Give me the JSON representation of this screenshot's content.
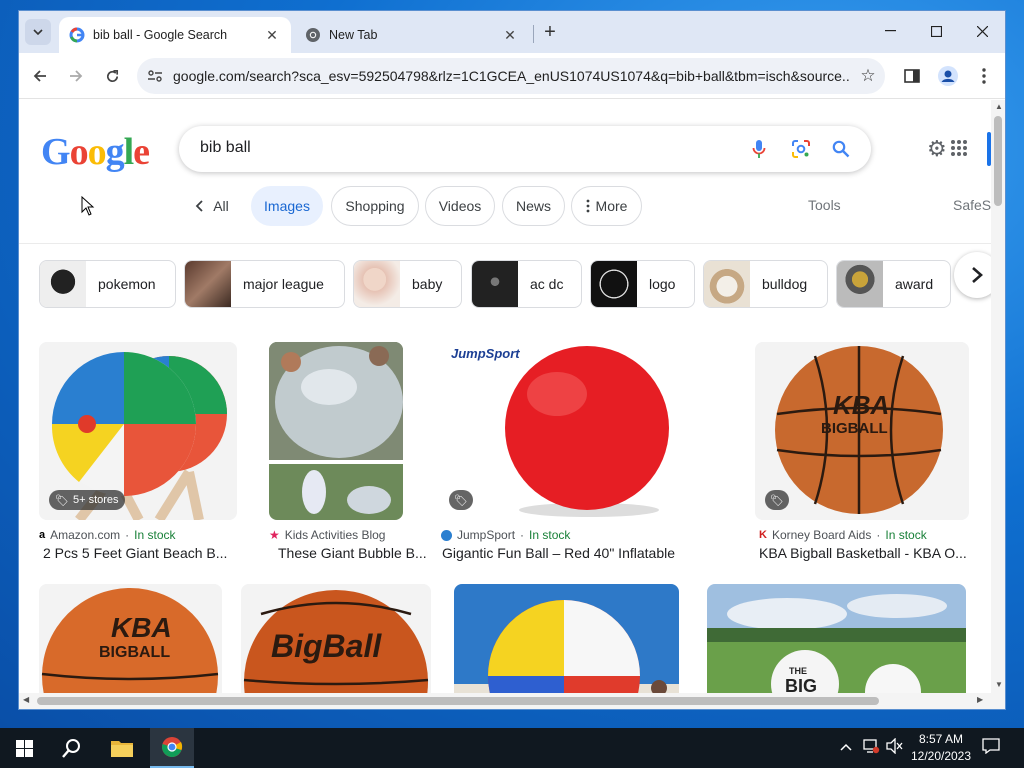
{
  "browser": {
    "tabs": [
      {
        "title": "bib ball - Google Search",
        "active": true
      },
      {
        "title": "New Tab",
        "active": false
      }
    ],
    "url": "google.com/search?sca_esv=592504798&rlz=1C1GCEA_enUS1074US1074&q=bib+ball&tbm=isch&source...",
    "icons": {
      "back": "back-arrow-icon",
      "forward": "forward-arrow-icon",
      "reload": "reload-icon",
      "bookmark": "star-icon",
      "sidepanel": "side-panel-icon",
      "profile": "profile-icon",
      "menu": "kebab-menu-icon"
    }
  },
  "google": {
    "logo_letters": [
      "G",
      "o",
      "o",
      "g",
      "l",
      "e"
    ],
    "logo_colors": [
      "#4285f4",
      "#ea4335",
      "#fbbc05",
      "#4285f4",
      "#34a853",
      "#ea4335"
    ],
    "query": "bib ball",
    "filters": {
      "back_all": "All",
      "chips": [
        "Images",
        "Shopping",
        "Videos",
        "News"
      ],
      "more": "More",
      "tools": "Tools",
      "safesearch": "SafeS"
    },
    "related": [
      {
        "label": "pokemon",
        "color": "#2b2b2b"
      },
      {
        "label": "major league",
        "color": "#6a4a3a"
      },
      {
        "label": "baby",
        "color": "#d9b9a6"
      },
      {
        "label": "ac dc",
        "color": "#2a2a2a"
      },
      {
        "label": "logo",
        "color": "#111111"
      },
      {
        "label": "bulldog",
        "color": "#c9b79a"
      },
      {
        "label": "award",
        "color": "#8a8a8a"
      }
    ],
    "results_row1": [
      {
        "source": "Amazon.com",
        "stock": "In stock",
        "title": "2 Pcs 5 Feet Giant Beach B...",
        "badge": "5+ stores"
      },
      {
        "source": "Kids Activities Blog",
        "stock": "",
        "title": "These Giant Bubble B...",
        "badge": ""
      },
      {
        "source": "JumpSport",
        "stock": "In stock",
        "title": "Gigantic Fun Ball – Red 40\" Inflatable",
        "badge": "",
        "img_text": "JumpSport"
      },
      {
        "source": "Korney Board Aids",
        "stock": "In stock",
        "title": "KBA Bigball Basketball - KBA O...",
        "badge": "",
        "img_text": "KBA",
        "img_text2": "BIGBALL"
      }
    ],
    "results_row2_text": [
      "KBA",
      "BIGBALL",
      "BigBall",
      "THE",
      "BIG"
    ],
    "stock_separator": "·"
  },
  "taskbar": {
    "time": "8:57 AM",
    "date": "12/20/2023"
  }
}
